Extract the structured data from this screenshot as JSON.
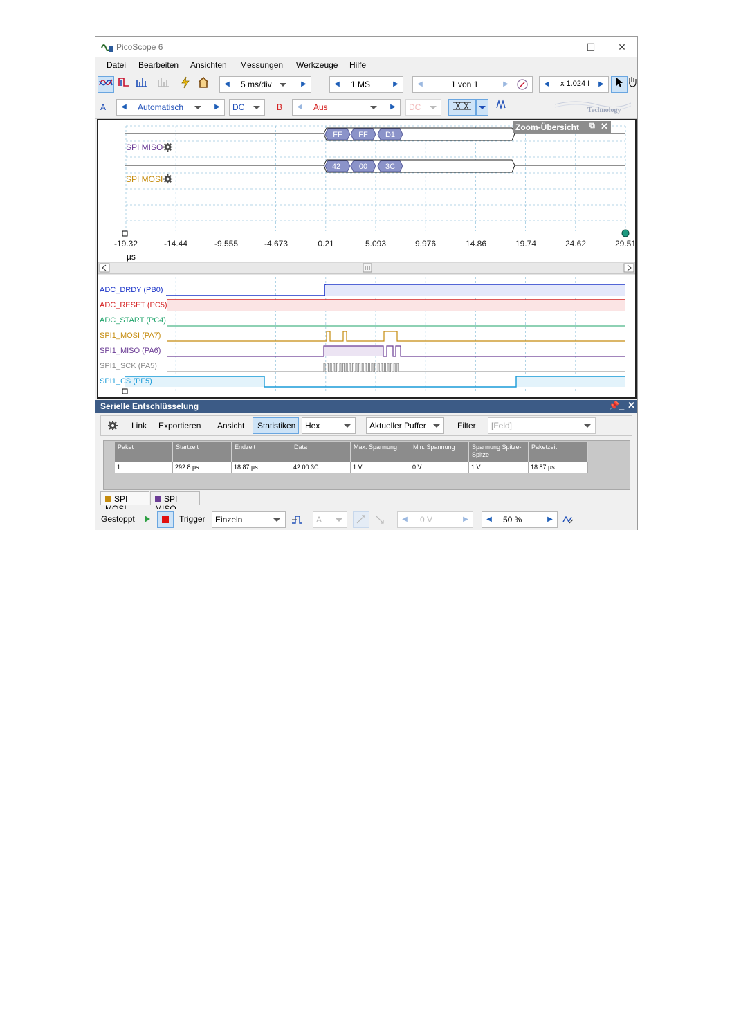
{
  "window": {
    "title": "PicoScope 6"
  },
  "menu": [
    "Datei",
    "Bearbeiten",
    "Ansichten",
    "Messungen",
    "Werkzeuge",
    "Hilfe"
  ],
  "toolbar1": {
    "timebase": "5 ms/div",
    "samples": "1 MS",
    "buffer": "1 von 1",
    "zoom": "x 1.024 I"
  },
  "toolbar2": {
    "channel_a_label": "A",
    "channel_a_range": "Automatisch",
    "channel_a_coupling": "DC",
    "channel_b_label": "B",
    "channel_b_range": "Aus",
    "channel_b_coupling": "DC",
    "brand": "Technology"
  },
  "scope": {
    "zoom_overview_title": "Zoom-Übersicht",
    "serial_channels": [
      {
        "name": "SPI MISO",
        "color": "#6b3c95",
        "packets": [
          "FF",
          "FF",
          "D1"
        ]
      },
      {
        "name": "SPI MOSI",
        "color": "#c58b0d",
        "packets": [
          "42",
          "00",
          "3C"
        ]
      }
    ],
    "x_ticks": [
      "-19.32",
      "-14.44",
      "-9.555",
      "-4.673",
      "0.21",
      "5.093",
      "9.976",
      "14.86",
      "19.74",
      "24.62",
      "29.51"
    ],
    "x_unit": "µs",
    "digital_channels": [
      {
        "name": "ADC_DRDY (PB0)",
        "color": "#1a33c8"
      },
      {
        "name": "ADC_RESET (PC5)",
        "color": "#d42020"
      },
      {
        "name": "ADC_START (PC4)",
        "color": "#1ea36a"
      },
      {
        "name": "SPI1_MOSI (PA7)",
        "color": "#c58b0d"
      },
      {
        "name": "SPI1_MISO (PA6)",
        "color": "#6b3c95"
      },
      {
        "name": "SPI1_SCK (PA5)",
        "color": "#8a8a8a"
      },
      {
        "name": "SPI1_CS (PF5)",
        "color": "#1a9bd8"
      }
    ]
  },
  "decoder": {
    "title": "Serielle Entschlüsselung",
    "buttons": [
      "Link",
      "Exportieren",
      "Ansicht",
      "Statistiken"
    ],
    "format": "Hex",
    "buffer": "Aktueller Puffer",
    "filter_label": "Filter",
    "field_placeholder": "[Feld]",
    "columns": [
      "Paket",
      "Startzeit",
      "Endzeit",
      "Data",
      "Max. Spannung",
      "Min. Spannung",
      "Spannung Spitze-Spitze",
      "Paketzeit"
    ],
    "rows": [
      [
        "1",
        "292.8 ps",
        "18.87 µs",
        "42 00 3C",
        "1 V",
        "0 V",
        "1 V",
        "18.87 µs"
      ]
    ],
    "tabs": [
      "SPI MOSI",
      "SPI MISO"
    ]
  },
  "statusbar": {
    "state": "Gestoppt",
    "trigger_label": "Trigger",
    "trigger_mode": "Einzeln",
    "trigger_source": "A",
    "threshold": "0 V",
    "pretrigger": "50 %"
  }
}
